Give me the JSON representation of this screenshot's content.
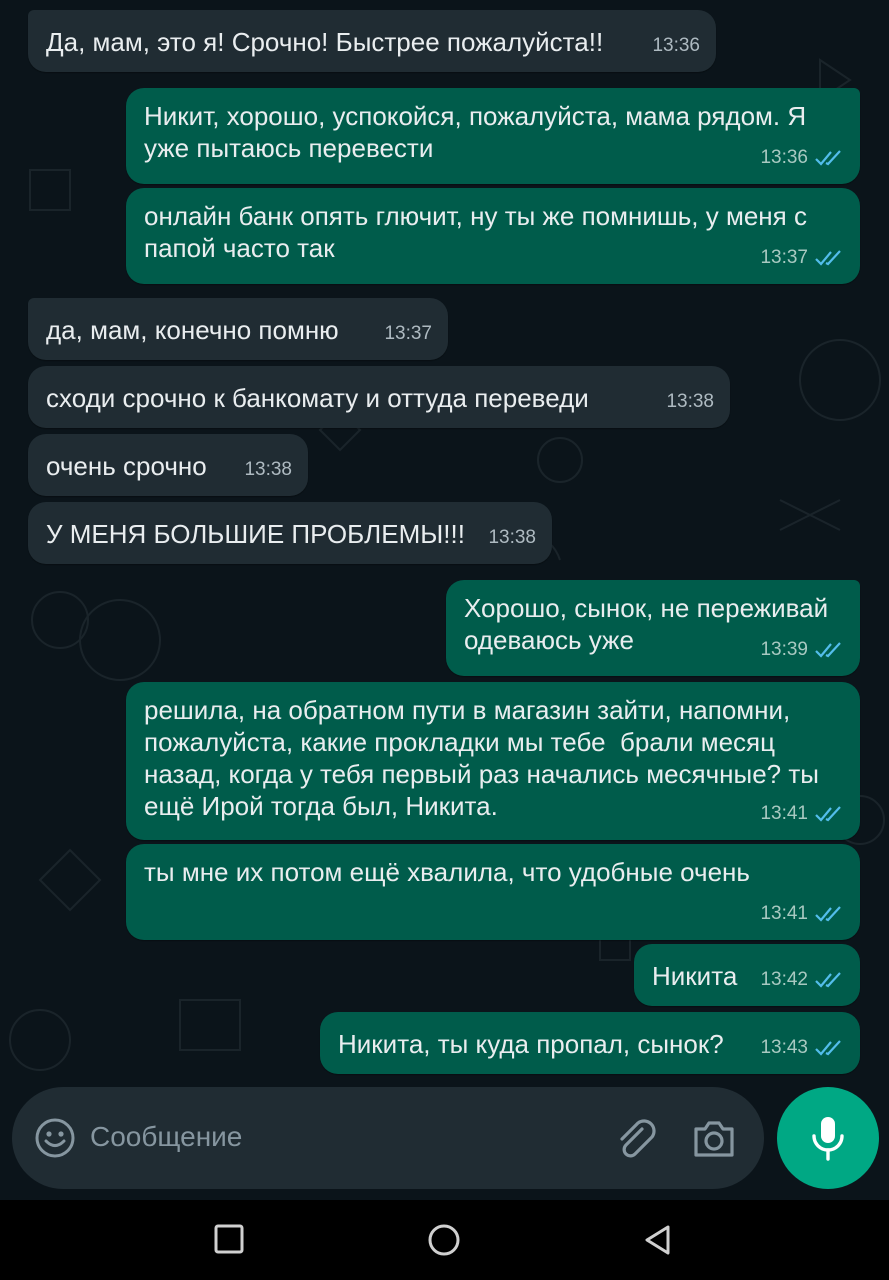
{
  "colors": {
    "background": "#0b141a",
    "incoming_bubble": "#202c33",
    "outgoing_bubble": "#005c4b",
    "read_ticks": "#53bdeb",
    "accent": "#00a884"
  },
  "messages": [
    {
      "direction": "incoming",
      "text": "Да, мам, это я! Срочно! Быстрее пожалуйста!!",
      "time": "13:36"
    },
    {
      "direction": "outgoing",
      "text": "Никит, хорошо, успокойся, пожалуйста, мама рядом. Я уже пытаюсь перевести",
      "time": "13:36",
      "status": "read"
    },
    {
      "direction": "outgoing",
      "text": "онлайн банк опять глючит, ну ты же помнишь, у меня с папой часто так",
      "time": "13:37",
      "status": "read"
    },
    {
      "direction": "incoming",
      "text": "да, мам, конечно помню",
      "time": "13:37"
    },
    {
      "direction": "incoming",
      "text": "сходи срочно к банкомату и оттуда переведи",
      "time": "13:38"
    },
    {
      "direction": "incoming",
      "text": "очень срочно",
      "time": "13:38"
    },
    {
      "direction": "incoming",
      "text": "У МЕНЯ БОЛЬШИЕ ПРОБЛЕМЫ!!!",
      "time": "13:38"
    },
    {
      "direction": "outgoing",
      "text": "Хорошо, сынок, не переживай одеваюсь уже",
      "time": "13:39",
      "status": "read"
    },
    {
      "direction": "outgoing",
      "text": "решила, на обратном пути в магазин зайти, напомни, пожалуйста, какие прокладки мы тебе  брали месяц назад, когда у тебя первый раз начались месячные? ты ещё Ирой тогда был, Никита.",
      "time": "13:41",
      "status": "read"
    },
    {
      "direction": "outgoing",
      "text": "ты мне их потом ещё хвалила, что удобные очень",
      "time": "13:41",
      "status": "read"
    },
    {
      "direction": "outgoing",
      "text": "Никита",
      "time": "13:42",
      "status": "read"
    },
    {
      "direction": "outgoing",
      "text": "Никита, ты куда пропал, сынок?",
      "time": "13:43",
      "status": "read"
    }
  ],
  "composer": {
    "placeholder": "Сообщение",
    "emoji_icon": "emoji-smile-icon",
    "attach_icon": "paperclip-icon",
    "camera_icon": "camera-icon",
    "mic_icon": "microphone-icon"
  },
  "navbar": {
    "icons": [
      "recent-apps-square-icon",
      "home-circle-icon",
      "back-triangle-icon"
    ]
  }
}
